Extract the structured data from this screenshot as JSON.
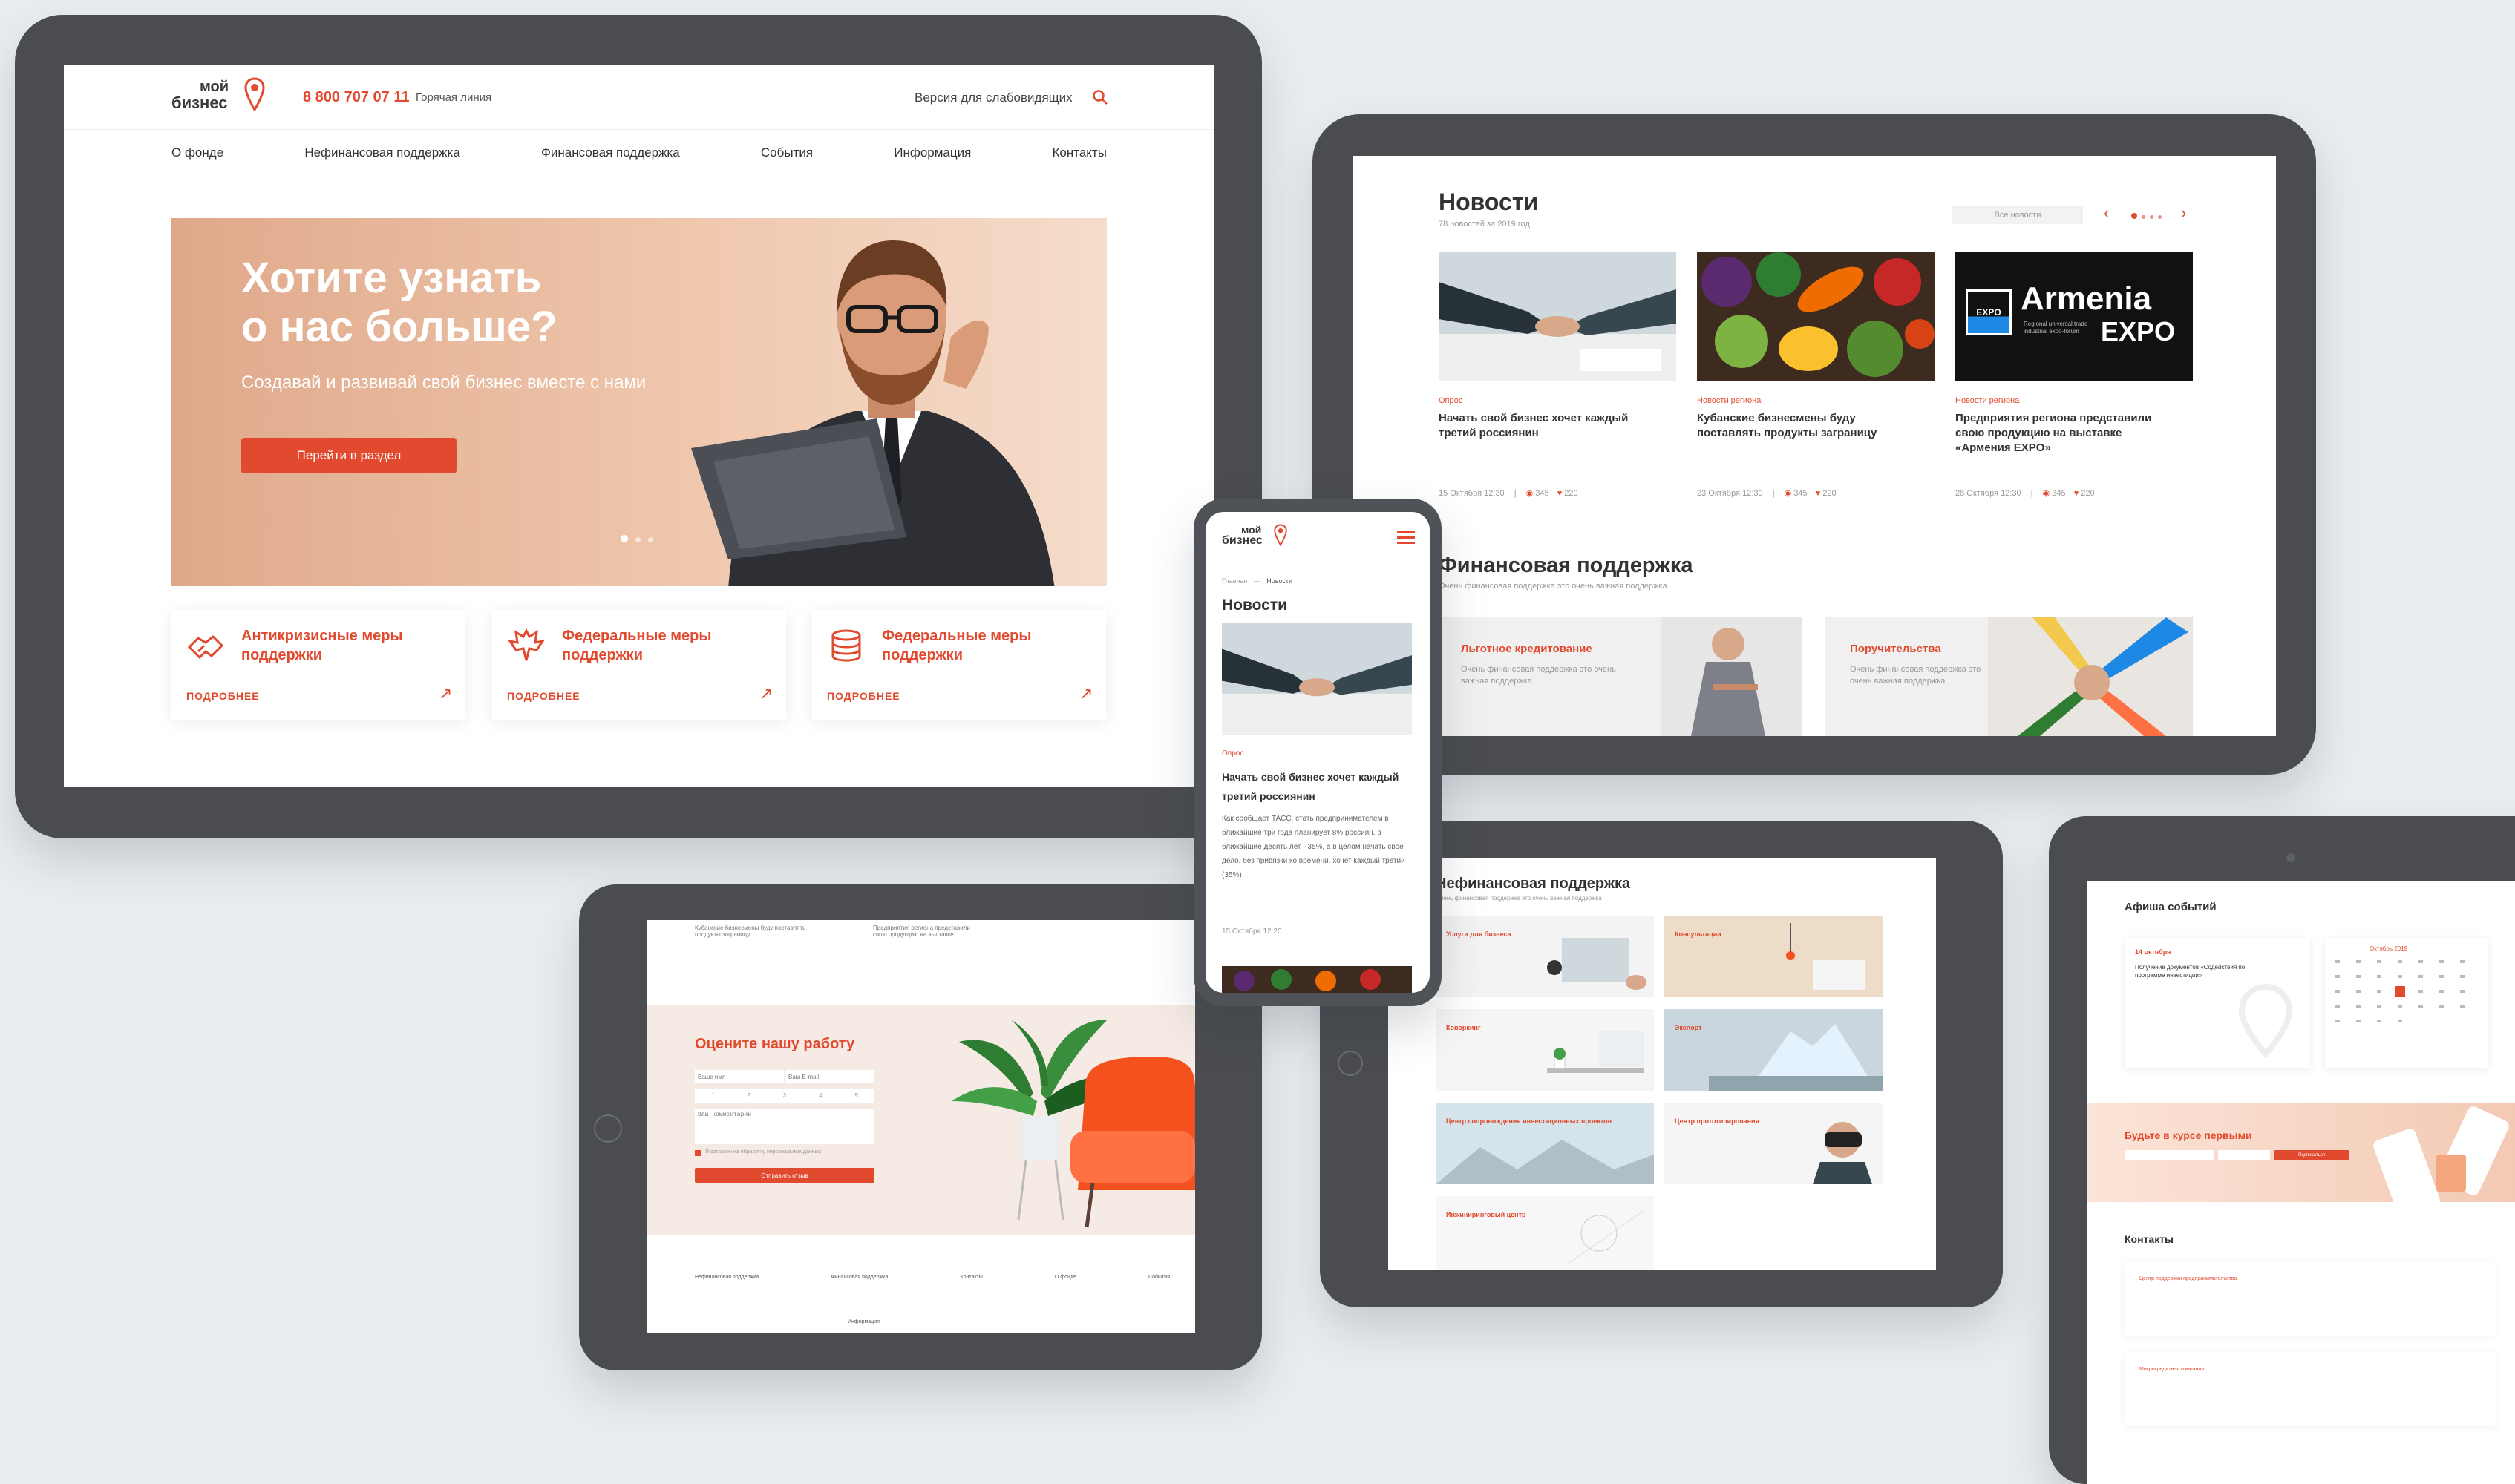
{
  "main_site": {
    "logo_line1": "мой",
    "logo_line2": "бизнес",
    "phone": "8 800 707 07 11",
    "hotline_label": "Горячая линия",
    "accessibility_label": "Версия для слабовидящих",
    "nav": [
      "О фонде",
      "Нефинансовая поддержка",
      "Финансовая поддержка",
      "События",
      "Информация",
      "Контакты"
    ],
    "hero": {
      "title_line1": "Хотите узнать",
      "title_line2": "о нас больше?",
      "subtitle": "Создавай и развивай свой бизнес вместе с нами",
      "button": "Перейти в раздел"
    },
    "cards": [
      {
        "title_line1": "Антикризисные меры",
        "title_line2": "поддержки",
        "link": "ПОДРОБНЕЕ",
        "icon": "handshake-icon"
      },
      {
        "title_line1": "Федеральные меры",
        "title_line2": "поддержки",
        "link": "ПОДРОБНЕЕ",
        "icon": "eagle-emblem-icon"
      },
      {
        "title_line1": "Федеральные меры",
        "title_line2": "поддержки",
        "link": "ПОДРОБНЕЕ",
        "icon": "coins-icon"
      }
    ]
  },
  "news_site": {
    "title": "Новости",
    "subtitle": "78 новостей за 2019 год",
    "all_news": "Все новости",
    "items": [
      {
        "category": "Опрос",
        "title": "Начать свой бизнес хочет каждый третий россиянин",
        "date": "15 Октября 12:30",
        "views": "345",
        "likes": "220"
      },
      {
        "category": "Новости региона",
        "title": "Кубанские бизнесмены буду поставлять продукты заграницу",
        "date": "23 Октября 12:30",
        "views": "345",
        "likes": "220"
      },
      {
        "category": "Новости региона",
        "title": "Предприятия региона представили свою продукцию на выставке «Армения EXPO»",
        "date": "28 Октября 12:30",
        "views": "345",
        "likes": "220"
      }
    ],
    "expo_word1": "Armenia",
    "expo_word2": "EXPO",
    "expo_logo": "EXPO",
    "expo_small": "Regional universal trade-industrial expo-forum",
    "finance_title": "Финансовая поддержка",
    "finance_subtitle": "Очень финансовая поддержка это очень важная поддержка",
    "finance_cards": [
      {
        "title": "Льготное кредитование",
        "text": "Очень финансовая поддержка это очень важная поддержка"
      },
      {
        "title": "Поручительства",
        "text": "Очень финансовая поддержка это очень важная поддержка"
      }
    ]
  },
  "mobile": {
    "logo_line1": "мой",
    "logo_line2": "бизнес",
    "breadcrumb_home": "Главная",
    "breadcrumb_current": "Новости",
    "title": "Новости",
    "category": "Опрос",
    "headline": "Начать свой бизнес хочет каждый третий россиянин",
    "body": "Как сообщает ТАСС, стать предпринимателем в ближайшие три года планирует 8% россиян, в ближайшие десять лет - 35%, а в целом начать свое дело, без привязки ко времени, хочет каждый третий (35%)",
    "date": "15 Октября 12:20"
  },
  "feedback_site": {
    "title": "Оцените нашу работу",
    "name_placeholder": "Ваше имя",
    "email_placeholder": "Ваш E-mail",
    "ratings": [
      "1",
      "2",
      "3",
      "4",
      "5"
    ],
    "comment_placeholder": "Ваш комментарий",
    "consent": "Я согласен на обработку персональных данных",
    "button": "Отправить отзыв",
    "top_snippets": [
      "Кубанские бизнесмены буду поставлять продукты заграницу",
      "Предприятия региона представили свою продукцию на выставке"
    ],
    "footer_cols": [
      "Нефинансовая поддержка",
      "Финансовая поддержка",
      "Контакты",
      "О фонде",
      "События"
    ],
    "footer_bottom": "Информация"
  },
  "nonfin_site": {
    "title": "Нефинансовая поддержка",
    "subtitle": "Очень финансовая поддержка это очень важная поддержка",
    "tiles": [
      {
        "title": "Услуги для бизнеса"
      },
      {
        "title": "Консультации"
      },
      {
        "title": "Коворкинг"
      },
      {
        "title": "Экспорт"
      },
      {
        "title": "Центр сопровождения инвестиционных проектов"
      },
      {
        "title": "Центр прототипирования"
      },
      {
        "title": "Инжиниринговый центр"
      }
    ]
  },
  "events_site": {
    "title": "Афиша событий",
    "event_date": "14 октября",
    "event_title": "Получение документов «Содействия по программе инвестиции»",
    "month": "Октябрь 2019",
    "subscribe_title": "Будьте в курсе первыми",
    "subscribe_button": "Подписаться",
    "contacts_title": "Контакты",
    "contact_rows": [
      "Центр поддержки предпринимательства",
      "Микрокредитная компания"
    ]
  },
  "colors": {
    "accent": "#e24a2f",
    "device_frame": "#4a4c50",
    "background": "#e9edf0",
    "hero_peach": "#e8b79c"
  }
}
